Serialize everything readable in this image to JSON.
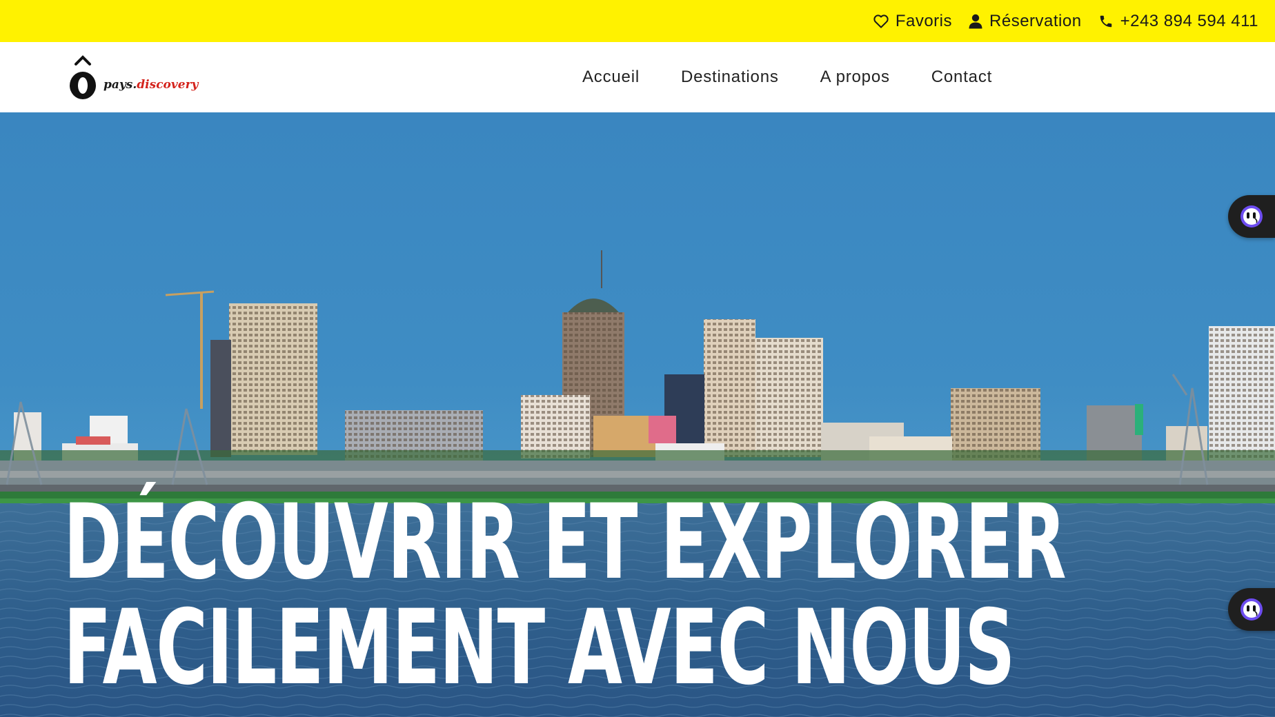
{
  "topbar": {
    "favorites_label": "Favoris",
    "reservation_label": "Réservation",
    "phone_label": "+243 894 594 411",
    "favorites_icon": "heart-icon",
    "reservation_icon": "user-icon",
    "phone_icon": "phone-icon",
    "background_color": "#fff200"
  },
  "header": {
    "logo": {
      "mark": "Ô",
      "text_part1": "pays.",
      "text_part2": "discovery"
    },
    "nav": [
      {
        "label": "Accueil"
      },
      {
        "label": "Destinations"
      },
      {
        "label": "A propos"
      },
      {
        "label": "Contact"
      }
    ]
  },
  "hero": {
    "title_line1": "DÉCOUVRIR ET EXPLORER",
    "title_line2": "FACILEMENT AVEC NOUS"
  },
  "widgets": {
    "icon": "chat-bot-icon"
  }
}
